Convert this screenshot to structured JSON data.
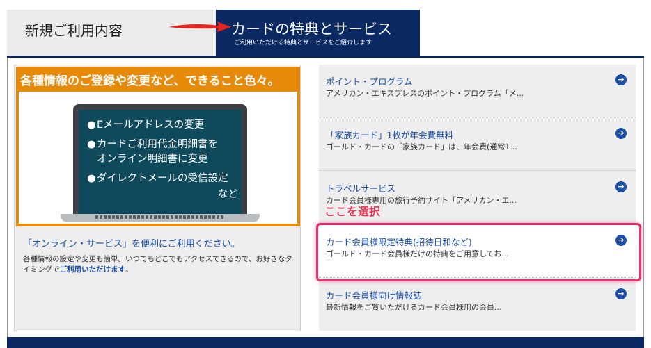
{
  "tabs": {
    "new": {
      "label": "新規ご利用内容"
    },
    "benefits": {
      "label": "カードの特典とサービス",
      "sub": "ご利用いただける特典とサービスをご紹介します"
    }
  },
  "left_panel": {
    "banner_title": "各種情報のご登録や変更など、できること色々。",
    "screen_items": [
      "Eメールアドレスの変更",
      "カードご利用代金明細書を",
      "オンライン明細書に変更",
      "ダイレクトメールの受信設定",
      "など"
    ],
    "bullet": "●",
    "link": "「オンライン・サービス」を便利にご利用ください。",
    "desc_main": "各種情報の設定や変更も簡単。いつでもどこでもアクセスできるので、お好きなタイミングで",
    "desc_em": "ご利用いただけます",
    "desc_end": "。"
  },
  "right_list": [
    {
      "title": "ポイント・プログラム",
      "desc": "アメリカン・エキスプレスのポイント・プログラム「メ..."
    },
    {
      "title": "「家族カード」1枚が年会費無料",
      "desc": "ゴールド・カードの「家族カード」は、年会費(通常1..."
    },
    {
      "title": "トラベルサービス",
      "desc": "カード会員様専用の旅行予約サイト「アメリカン・エ..."
    },
    {
      "title": "カード会員様限定特典(招待日和など)",
      "desc": "ゴールド・カード会員様だけの特典をご用意してお..."
    },
    {
      "title": "カード会員様向け情報誌",
      "desc": "最新情報をご覧いただけるカード会員様用の会員..."
    }
  ],
  "go_glyph": "➔",
  "annotation": {
    "callout": "ここを選択"
  },
  "colors": {
    "navy": "#0b2a63",
    "orange": "#e78a0a",
    "link_blue": "#1a4ea8",
    "highlight": "#e8336d",
    "arrow_red": "#e8231f"
  }
}
